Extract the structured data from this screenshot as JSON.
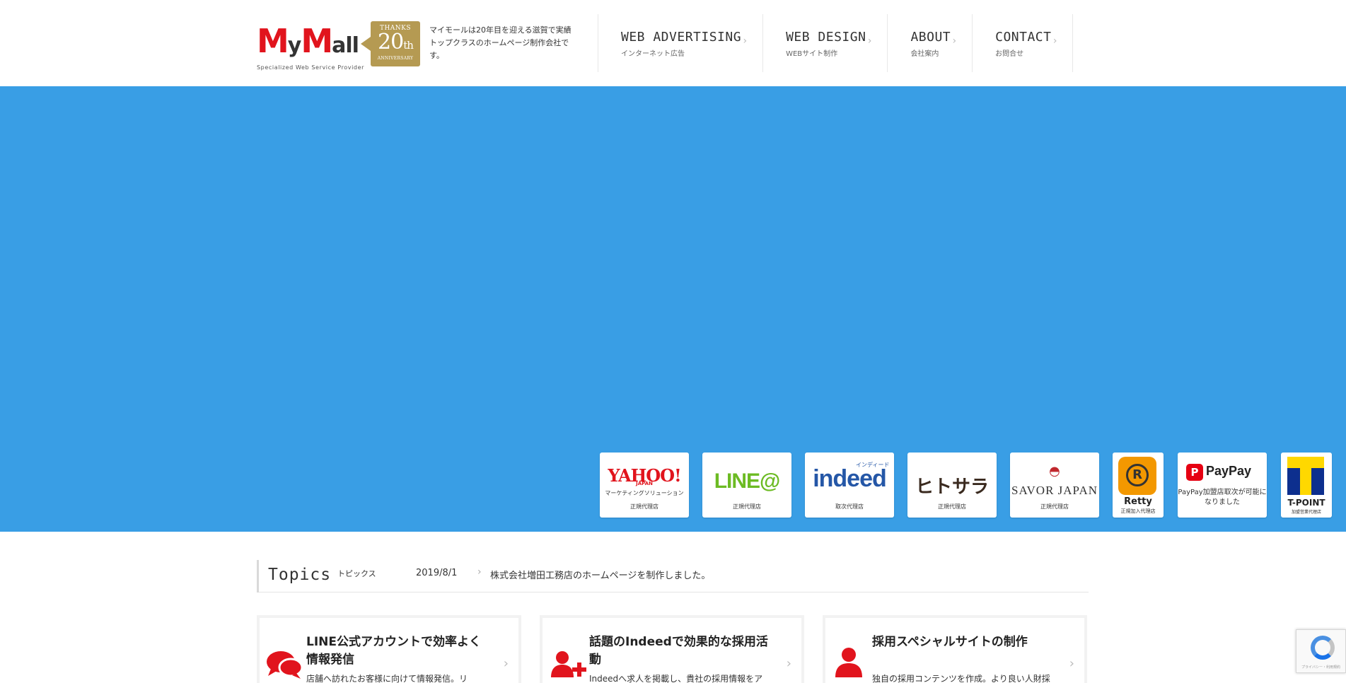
{
  "header": {
    "logo": "MyMall",
    "logo_sub": "Specialized Web Service Provider",
    "badge": {
      "top": "THANKS",
      "number": "20",
      "suffix": "th",
      "bottom": "ANNIVERSARY"
    },
    "tagline": "マイモールは20年目を迎える滋賀で実績トップクラスのホームページ制作会社です。",
    "nav": [
      {
        "title": "WEB ADVERTISING",
        "sub": "インターネット広告"
      },
      {
        "title": "WEB DESIGN",
        "sub": "WEBサイト制作"
      },
      {
        "title": "ABOUT",
        "sub": "会社案内"
      },
      {
        "title": "CONTACT",
        "sub": "お問合せ"
      }
    ]
  },
  "hero": {
    "background": "#399ee5",
    "partners": [
      {
        "name": "YAHOO!",
        "sub": "JAPAN",
        "label": "マーケティングソリューション",
        "caption": "正規代理店"
      },
      {
        "name": "LINE@",
        "caption": "正規代理店"
      },
      {
        "name": "indeed",
        "kana": "インディード",
        "caption": "取次代理店"
      },
      {
        "name": "ヒトサラ",
        "caption": "正規代理店"
      },
      {
        "name": "SAVOR JAPAN",
        "caption": "正規代理店"
      },
      {
        "name": "Retty",
        "caption": "正規加入代理店"
      },
      {
        "name": "PayPay",
        "message": "PayPay加盟店取次が可能になりました"
      },
      {
        "name": "T-POINT",
        "caption": "加盟営業代理店"
      }
    ]
  },
  "topics": {
    "title": "Topics",
    "kana": "トピックス",
    "date": "2019/8/1",
    "link": "株式会社増田工務店のホームページを制作しました。"
  },
  "cards": [
    {
      "title": "LINE公式アカウントで効率よく情報発信",
      "desc": "店舗へ訪れたお客様に向けて情報発信。リ",
      "icon": "chat-bubbles-icon"
    },
    {
      "title": "話題のIndeedで効果的な採用活動",
      "desc": "Indeedへ求人を掲載し、貴社の採用情報をア",
      "icon": "add-user-icon"
    },
    {
      "title": "採用スペシャルサイトの制作",
      "desc": "独自の採用コンテンツを作成。より良い人財採用の実現をご協力します。",
      "icon": "person-icon"
    }
  ],
  "recaptcha": {
    "text": "プライバシー・利用規約"
  },
  "colors": {
    "brand_red": "#e1141d",
    "gold": "#b59a52",
    "hero_blue": "#399ee5"
  }
}
